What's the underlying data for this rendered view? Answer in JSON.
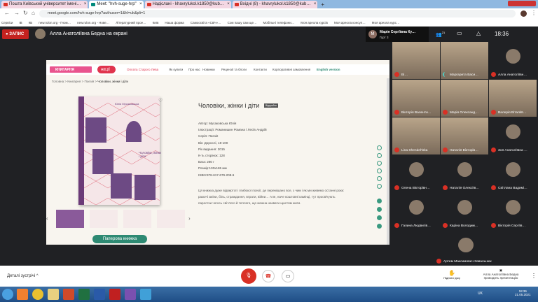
{
  "browser": {
    "tabs": [
      "Пошта Київський університет імені…",
      "Meet: \"hvh-suge-hrp\"",
      "Надіслані - khavrylukol.k1850@kub…",
      "Вхідні (8) - khavrylukol.k1850@kub…"
    ],
    "url": "meet.google.com/hvh-suge-hrp?authuser=1&hl=uk&pli=1",
    "bookmarks": [
      "Сервіси",
      "ІВ",
      "КБ",
      "",
      "",
      "",
      "",
      "new.rulon.org - Гном…",
      "new.rulon.org - Нове…",
      "Літературний прое…",
      "Київ",
      "Наша форма",
      "Самоосвіта «Свіч»…",
      "Сом пашу сам ще…",
      "Мобільні телефони…",
      "Моя ареола курсів",
      "Моя ареола консул…",
      "Моя ареола курс…"
    ]
  },
  "meet": {
    "record_label": "ЗАПИС",
    "presenter_label": "Алла Анатоліївна Бедна на екрані",
    "self_name": "Марія Сергіївна Ку…",
    "self_sub": "Гурт 3",
    "participants_count": "21",
    "time": "18:36",
    "details_label": "Деталі зустрічі",
    "raise_hand": "Підняти руку",
    "presenting": "Алла Анатоліївна Бедна проводить презентацію"
  },
  "site": {
    "logo": "КНИГАРНЯ",
    "sale": "АКЦІЇ",
    "nav": [
      "Оплата Старого Лева",
      "Як купити",
      "Про нас",
      "Новинки",
      "Рецензії та блоги",
      "Контакти",
      "Корпоративні замовлення",
      "English version"
    ],
    "breadcrumb": [
      "Головна",
      "Книгарня",
      "Поезія",
      "Чоловіки, жінки і діти"
    ],
    "title": "Чоловіки, жінки і діти",
    "badge": "Відкрийте",
    "details": [
      "Автор: Мусаковська Юлія",
      "Ілюстрації: Романишин Романа і Лесів Андрій",
      "Серія: Поезія",
      "Вік: Дорослі, 18-100",
      "Рік видання: 2015",
      "К-ть сторінок: 128",
      "Вага: 280 г",
      "Розмір:130х165 мм",
      "ISBN:978-617-679-208-6"
    ],
    "description": "Ця книжка дуже відвертої і глибокої поезії, де перемішано все, з чим і як ми живемо останні роки: разючі зміни, біль, страждання, втрати, війни… Але, наче коштовні камінці, тут просвічують паростки чогось світлого й теплого, що можна назвати щастям жити.",
    "paper_button": "Паперова книжка",
    "cover_author": "Юлія Мусаковська",
    "cover_title": "Чоловіки, жінки і діти"
  },
  "participants": [
    "Ві…",
    "Маргарита Васи…",
    "Алла Анатоліївн…",
    "Вікторія Валенти…",
    "Марія Олександ…",
    "Валерія Віталіїв…",
    "Lina Shendel'iska",
    "Наталія Вікторів…",
    "Зоя Анатоліївна …",
    "Олена Вікторівн…",
    "Наталія Олексіїв…",
    "Світлана Вадимі…",
    "Галина Людвигів…",
    "Каріна Володим…",
    "Вікторія Сергіїв…",
    "Артем Максимович Завальнюк"
  ],
  "taskbar": {
    "lang": "UK",
    "clock": "18:36",
    "date": "21.05.2021"
  }
}
